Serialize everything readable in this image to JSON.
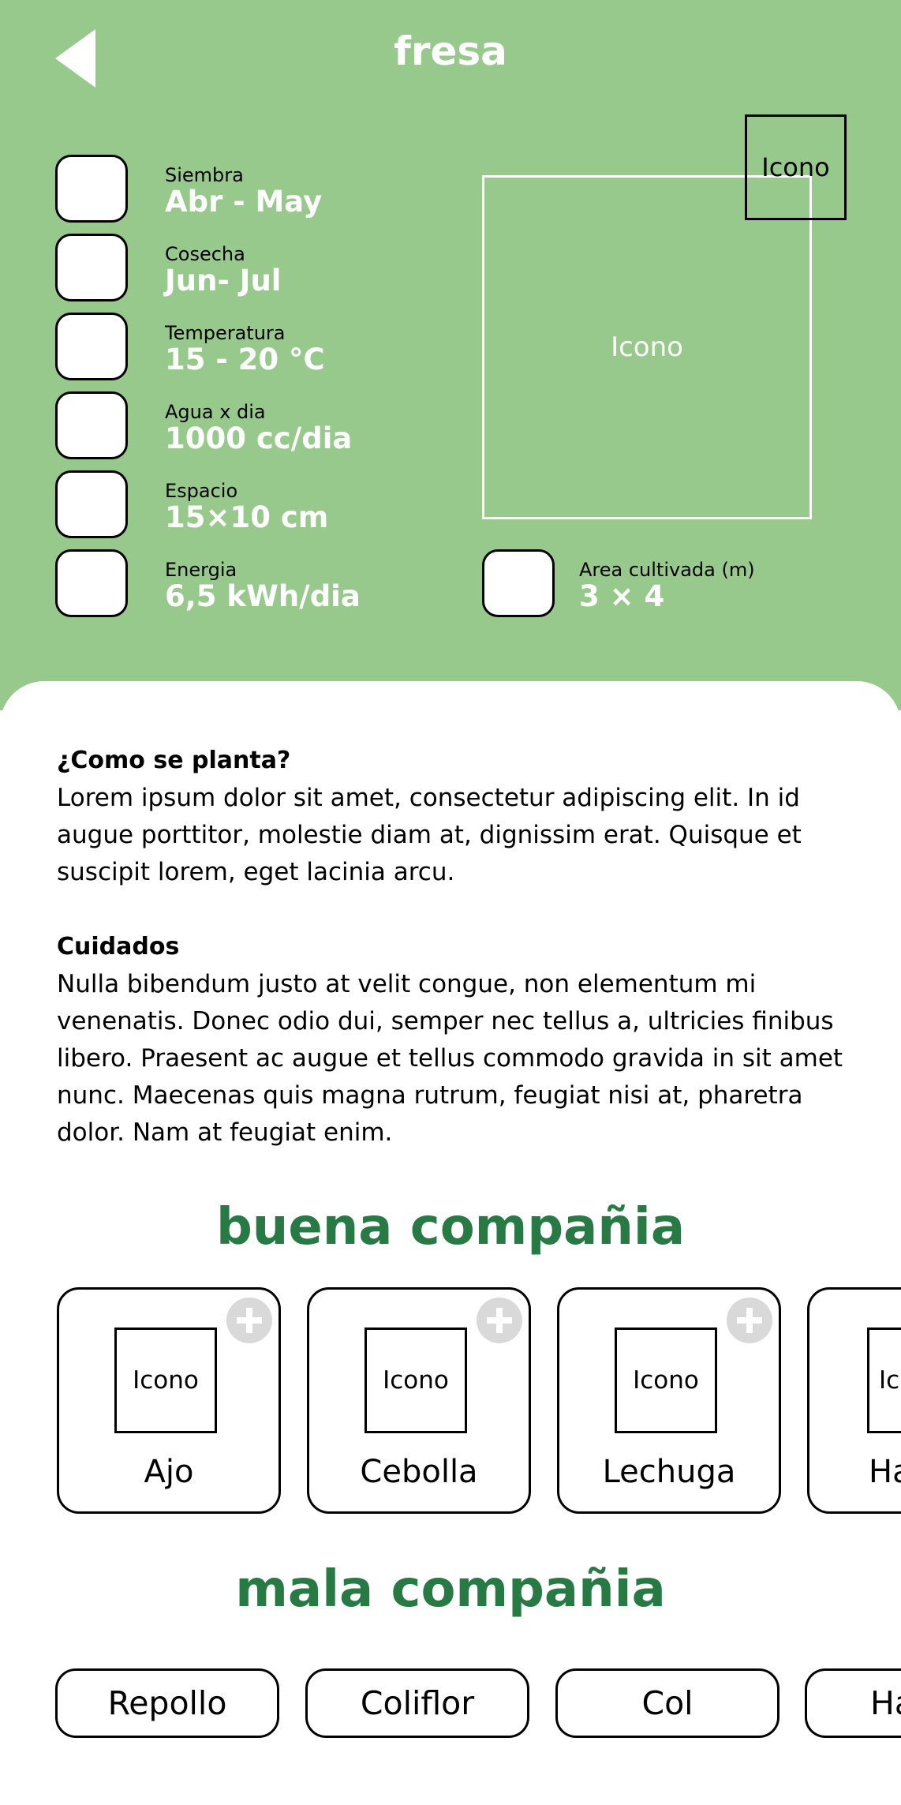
{
  "header": {
    "title": "fresa",
    "stats": [
      {
        "label": "Siembra",
        "value": "Abr - May"
      },
      {
        "label": "Cosecha",
        "value": "Jun- Jul"
      },
      {
        "label": "Temperatura",
        "value": "15 - 20 °C"
      },
      {
        "label": "Agua x dia",
        "value": "1000 cc/dia"
      },
      {
        "label": "Espacio",
        "value": "15×10 cm"
      },
      {
        "label": "Energia",
        "value": "6,5 kWh/dia"
      }
    ],
    "area": {
      "label": "Area cultivada (m)",
      "value": "3 × 4"
    },
    "big_icon_label": "Icono",
    "small_icon_label": "Icono"
  },
  "content": {
    "how_title": "¿Como se planta?",
    "how_text": "Lorem ipsum dolor sit amet, consectetur adipiscing elit. In id augue porttitor, molestie diam at, dignissim erat. Quisque et suscipit lorem, eget lacinia arcu.",
    "care_title": "Cuidados",
    "care_text": "Nulla bibendum justo at velit congue, non elementum mi venenatis. Donec odio dui, semper nec tellus a, ultricies finibus libero. Praesent ac augue et tellus commodo gravida in sit amet nunc. Maecenas quis magna rutrum, feugiat nisi at, pharetra dolor. Nam at feugiat enim."
  },
  "good_companions": {
    "title": "buena compañia",
    "items": [
      {
        "icon": "Icono",
        "name": "Ajo"
      },
      {
        "icon": "Icono",
        "name": "Cebolla"
      },
      {
        "icon": "Icono",
        "name": "Lechuga"
      },
      {
        "icon": "Ic",
        "name": "Ha"
      }
    ]
  },
  "bad_companions": {
    "title": "mala compañia",
    "items": [
      "Repollo",
      "Coliflor",
      "Col",
      "Ha"
    ]
  },
  "colors": {
    "header_bg": "#98c98c",
    "accent_green": "#287a45",
    "plus_gray": "#d9d9d9"
  }
}
